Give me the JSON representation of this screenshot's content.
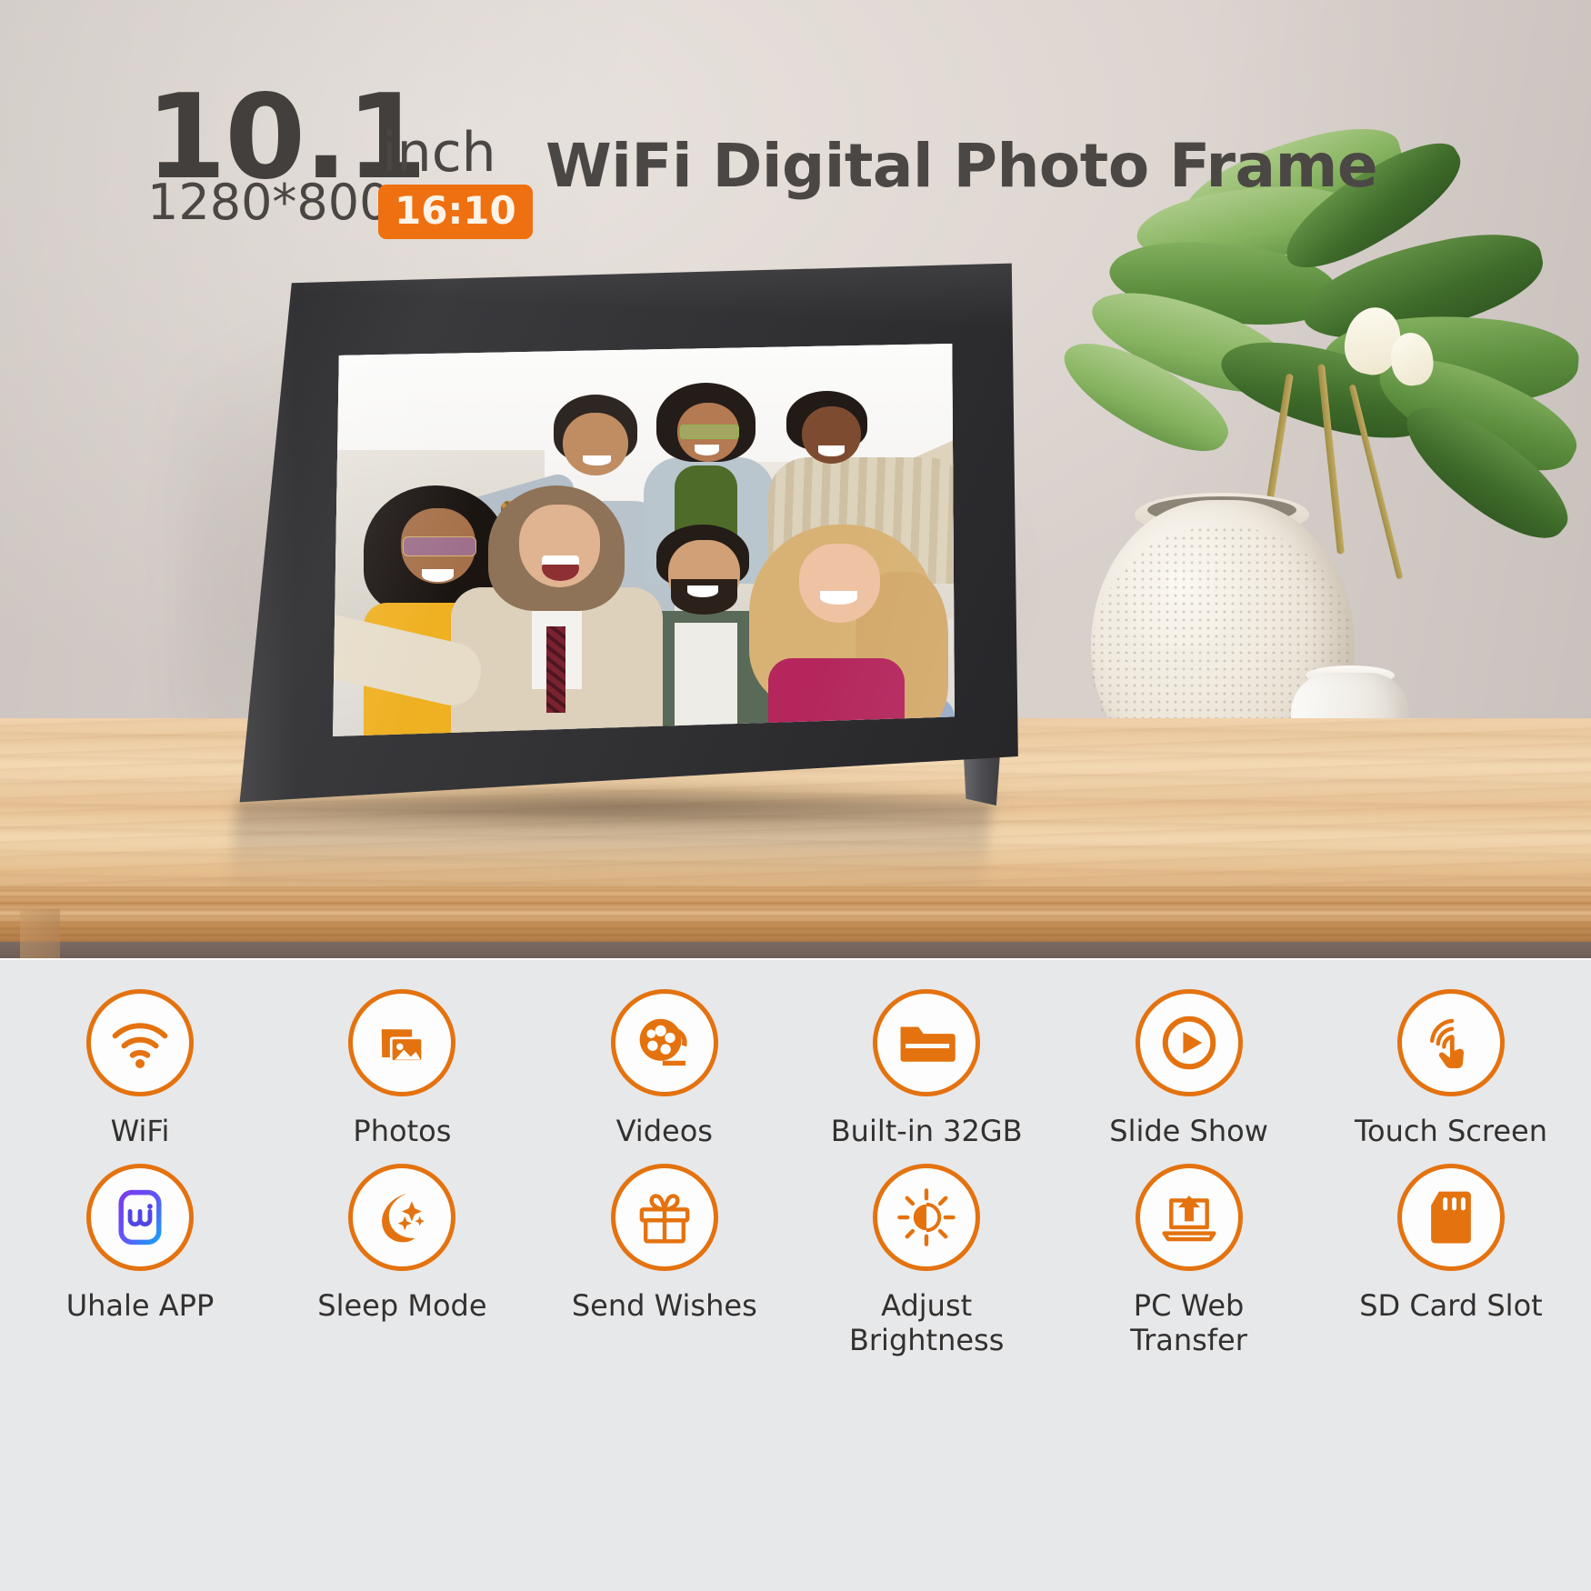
{
  "header": {
    "size_number": "10.1",
    "size_unit": "inch",
    "resolution": "1280*800",
    "aspect_ratio": "16:10",
    "title": "WiFi Digital Photo Frame"
  },
  "colors": {
    "accent_orange": "#e4720f",
    "badge_orange": "#ef7010",
    "headline_gray": "#4b4744",
    "panel_bg": "#e7e8ea",
    "frame_black": "#2f2f32",
    "wall": "#e2dbd6",
    "table_wood": "#eccba2"
  },
  "scene": {
    "device": "digital-photo-frame",
    "screen_content": "group-selfie-photo",
    "props": [
      "potted-plant",
      "ceramic-vase",
      "small-vase",
      "wooden-table"
    ]
  },
  "features": {
    "row1": [
      {
        "icon": "wifi-icon",
        "label": "WiFi"
      },
      {
        "icon": "photos-icon",
        "label": "Photos"
      },
      {
        "icon": "videos-icon",
        "label": "Videos"
      },
      {
        "icon": "folder-icon",
        "label": "Built-in 32GB"
      },
      {
        "icon": "slideshow-play-icon",
        "label": "Slide Show"
      },
      {
        "icon": "touch-screen-icon",
        "label": "Touch Screen"
      }
    ],
    "row2": [
      {
        "icon": "uhale-app-icon",
        "label": "Uhale APP"
      },
      {
        "icon": "sleep-moon-icon",
        "label": "Sleep Mode"
      },
      {
        "icon": "gift-icon",
        "label": "Send Wishes"
      },
      {
        "icon": "brightness-sun-icon",
        "label": "Adjust\nBrightness"
      },
      {
        "icon": "pc-web-transfer-icon",
        "label": "PC Web\nTransfer"
      },
      {
        "icon": "sd-card-icon",
        "label": "SD Card Slot"
      }
    ]
  }
}
